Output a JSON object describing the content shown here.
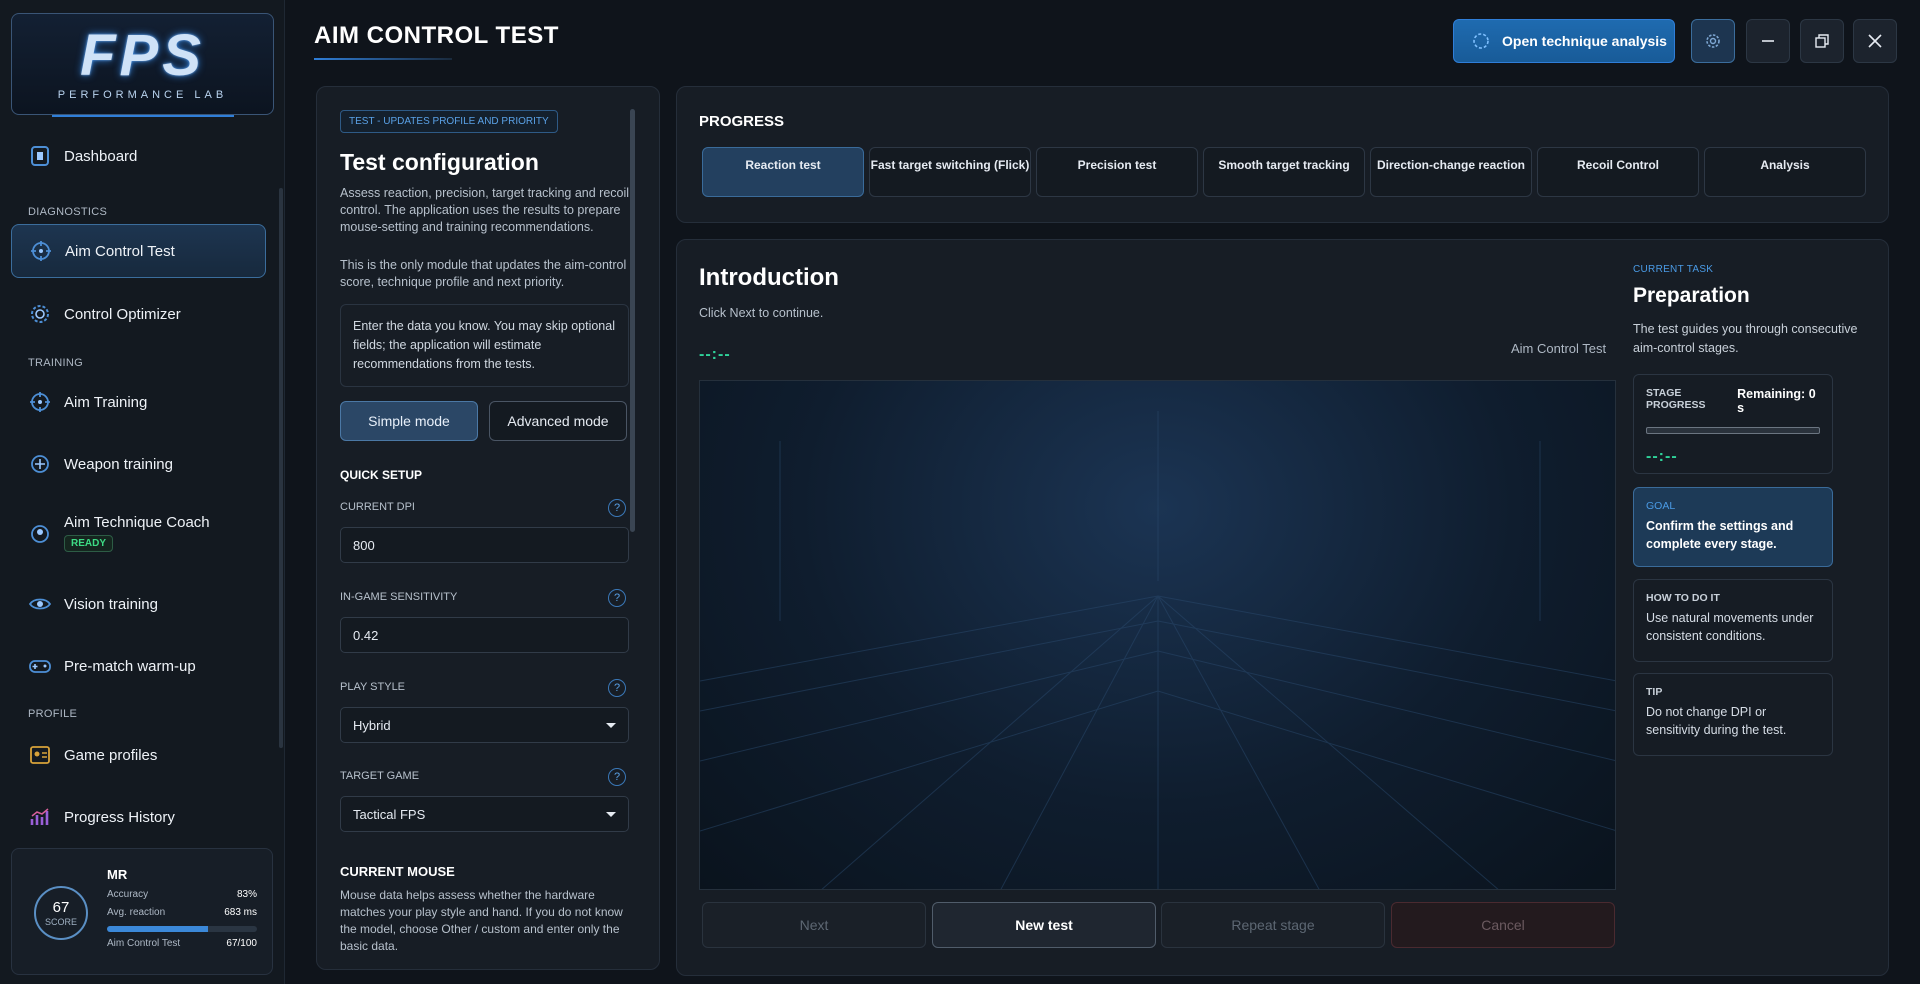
{
  "app": {
    "logo_main": "FPS",
    "logo_sub": "PERFORMANCE LAB",
    "page_title": "AIM CONTROL TEST",
    "analysis_button": "Open technique analysis"
  },
  "sidebar": {
    "sections": {
      "diagnostics": "DIAGNOSTICS",
      "training": "TRAINING",
      "profile": "PROFILE"
    },
    "items": [
      {
        "label": "Dashboard",
        "icon": "dashboard-icon"
      },
      {
        "label": "Aim Control Test",
        "icon": "crosshair-icon",
        "active": true
      },
      {
        "label": "Control Optimizer",
        "icon": "target-gear-icon"
      },
      {
        "label": "Aim Training",
        "icon": "crosshair-icon"
      },
      {
        "label": "Weapon training",
        "icon": "weapon-icon"
      },
      {
        "label": "Aim Technique Coach",
        "icon": "coach-icon",
        "badge": "READY"
      },
      {
        "label": "Vision training",
        "icon": "eye-icon"
      },
      {
        "label": "Pre-match warm-up",
        "icon": "gamepad-icon"
      },
      {
        "label": "Game profiles",
        "icon": "profile-card-icon"
      },
      {
        "label": "Progress History",
        "icon": "chart-icon"
      }
    ],
    "user": {
      "initials": "MR",
      "score": "67",
      "score_label": "SCORE",
      "accuracy_label": "Accuracy",
      "accuracy": "83%",
      "reaction_label": "Avg. reaction",
      "reaction": "683 ms",
      "test_label": "Aim Control Test",
      "test_score": "67/100",
      "test_progress": 0.67
    }
  },
  "config": {
    "tag": "TEST - UPDATES PROFILE AND PRIORITY",
    "title": "Test configuration",
    "desc1": "Assess reaction, precision, target tracking and recoil control. The application uses the results to prepare mouse-setting and training recommendations.",
    "desc2": "This is the only module that updates the aim-control score, technique profile and next priority.",
    "info": "Enter the data you know. You may skip optional fields; the application will estimate recommendations from the tests.",
    "simple_mode": "Simple mode",
    "advanced_mode": "Advanced mode",
    "quick_setup": "QUICK SETUP",
    "dpi_label": "CURRENT DPI",
    "dpi_value": "800",
    "sens_label": "IN-GAME SENSITIVITY",
    "sens_value": "0.42",
    "style_label": "PLAY STYLE",
    "style_value": "Hybrid",
    "game_label": "TARGET GAME",
    "game_value": "Tactical FPS",
    "help": "?",
    "mouse_title": "CURRENT MOUSE",
    "mouse_desc": "Mouse data helps assess whether the hardware matches your play style and hand. If you do not know the model, choose Other / custom and enter only the basic data."
  },
  "progress": {
    "title": "PROGRESS",
    "tabs": [
      {
        "label": "Reaction test",
        "active": true
      },
      {
        "label": "Fast target switching (Flick)"
      },
      {
        "label": "Precision test"
      },
      {
        "label": "Smooth target tracking"
      },
      {
        "label": "Direction-change reaction"
      },
      {
        "label": "Recoil Control"
      },
      {
        "label": "Analysis"
      }
    ]
  },
  "stage": {
    "title": "Introduction",
    "subtitle": "Click Next to continue.",
    "timer": "--:--",
    "arena_label": "Aim Control Test",
    "next": "Next",
    "new_test": "New test",
    "repeat": "Repeat stage",
    "cancel": "Cancel"
  },
  "task": {
    "tag": "CURRENT TASK",
    "title": "Preparation",
    "desc": "The test guides you through consecutive aim-control stages.",
    "stage_progress_label": "STAGE PROGRESS",
    "remaining": "Remaining: 0 s",
    "stage_timer": "--:--",
    "stage_progress": 0,
    "goal_label": "GOAL",
    "goal": "Confirm the settings and complete every stage.",
    "how_label": "HOW TO DO IT",
    "how": "Use natural movements under consistent conditions.",
    "tip_label": "TIP",
    "tip": "Do not change DPI or sensitivity during the test."
  },
  "colors": {
    "accent": "#2f7ed8",
    "active": "#23405f",
    "timer": "#2fd39a"
  }
}
